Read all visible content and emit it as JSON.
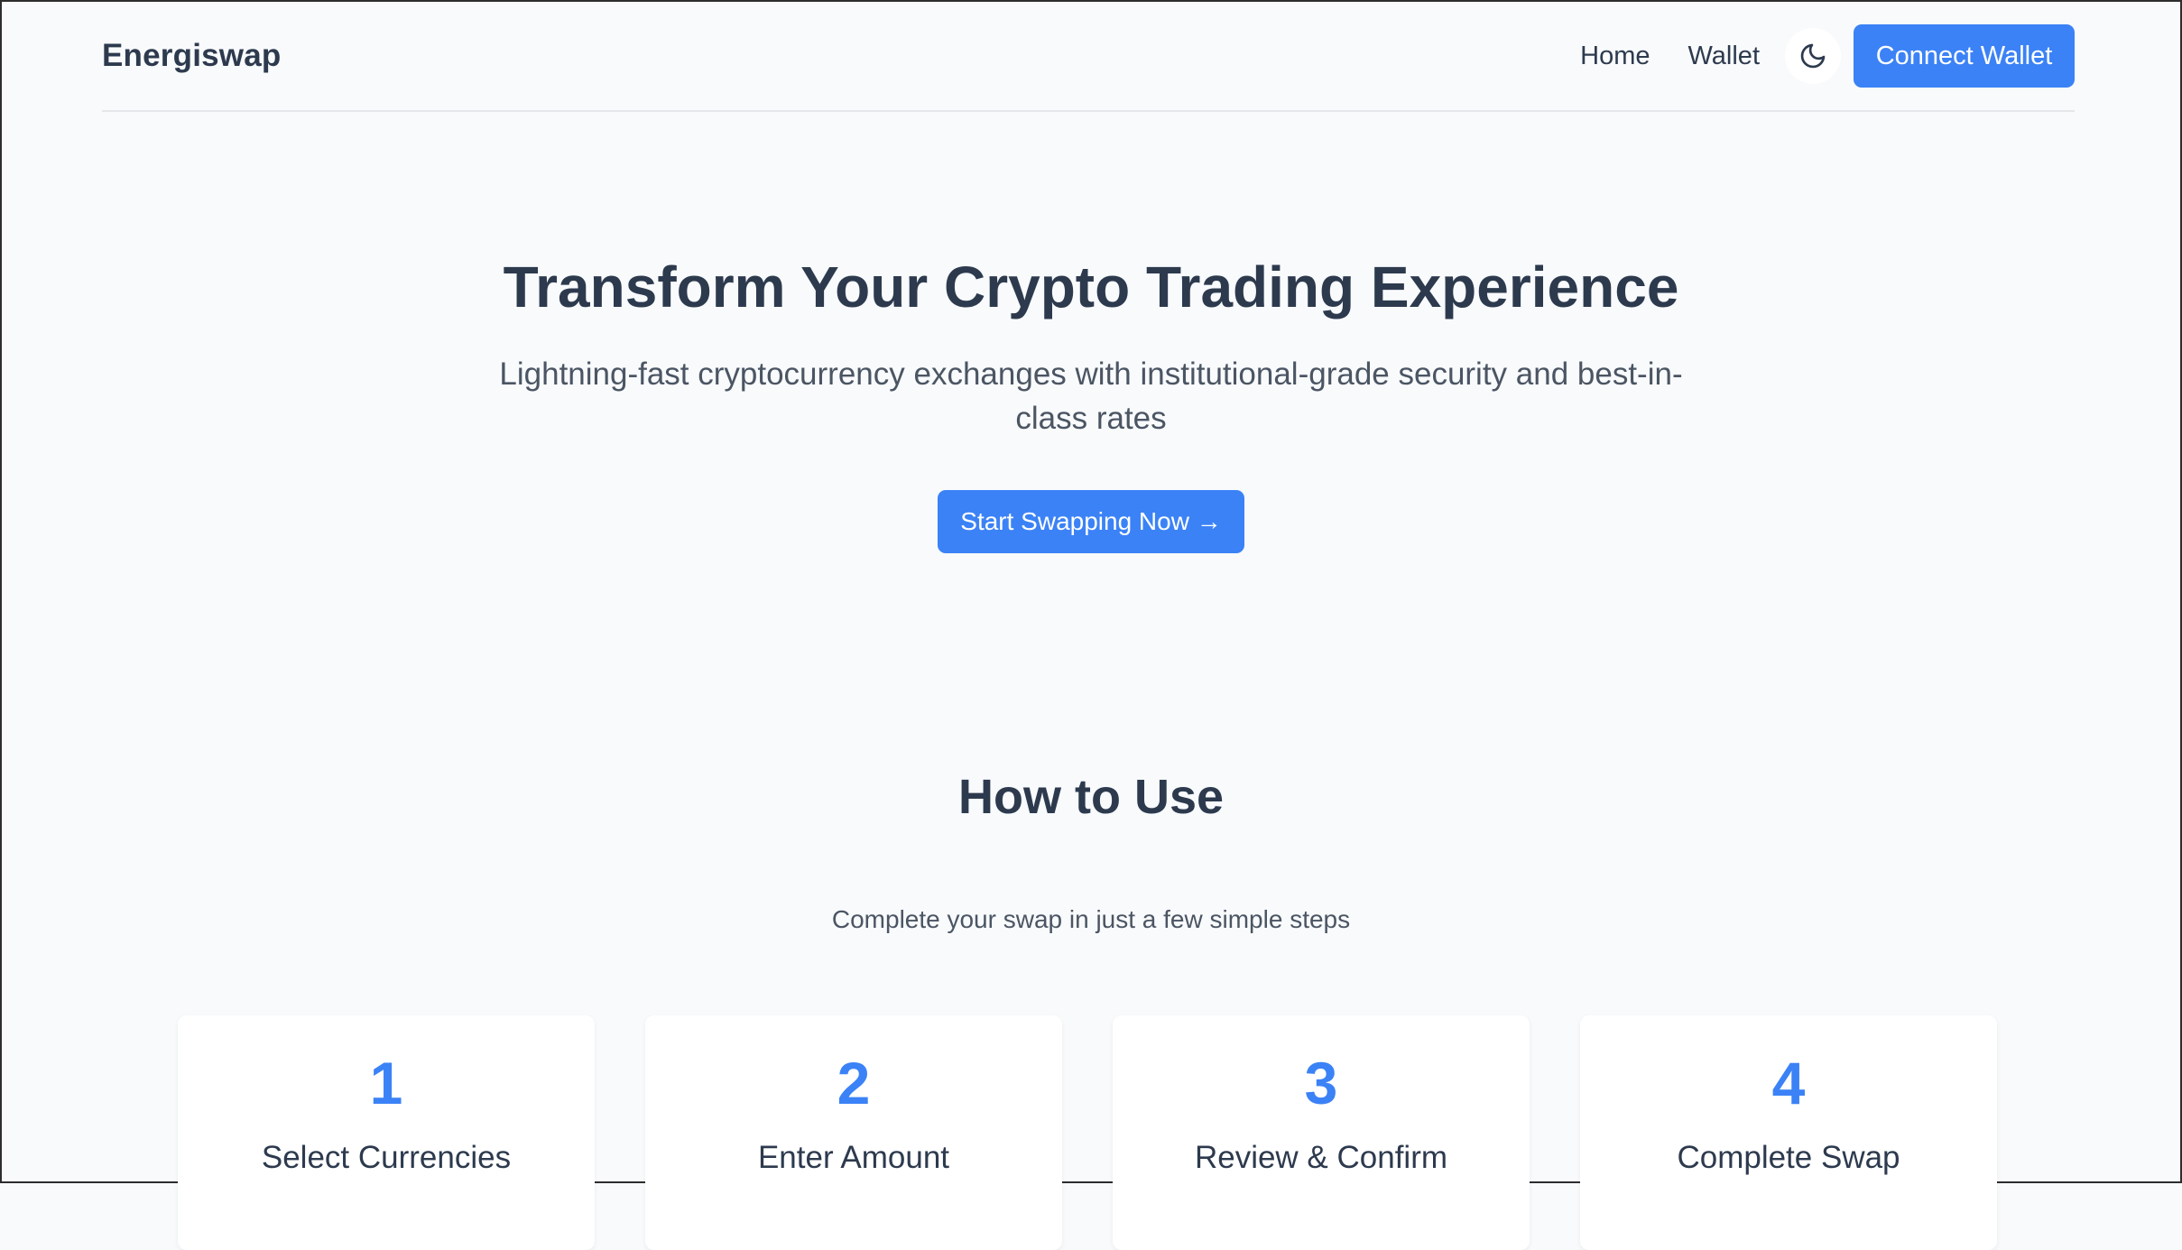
{
  "navbar": {
    "brand": "Energiswap",
    "links": {
      "home": "Home",
      "wallet": "Wallet"
    },
    "theme_icon": "moon-icon",
    "connect_label": "Connect Wallet"
  },
  "hero": {
    "title": "Transform Your Crypto Trading Experience",
    "subtitle": "Lightning-fast cryptocurrency exchanges with institutional-grade security and best-in-class rates",
    "cta_label": "Start Swapping Now →"
  },
  "how_to_use": {
    "title": "How to Use",
    "subtitle": "Complete your swap in just a few simple steps",
    "steps": [
      {
        "number": "1",
        "label": "Select Currencies"
      },
      {
        "number": "2",
        "label": "Enter Amount"
      },
      {
        "number": "3",
        "label": "Review & Confirm"
      },
      {
        "number": "4",
        "label": "Complete Swap"
      }
    ]
  },
  "colors": {
    "accent": "#3b82f6",
    "background": "#f8fafc",
    "text_dark": "#2d3a4e",
    "text_muted": "#4b5563"
  }
}
